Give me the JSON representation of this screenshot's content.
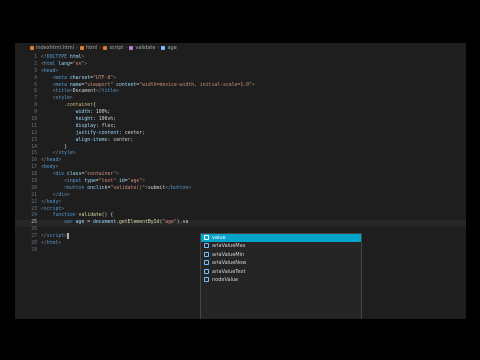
{
  "breadcrumb": [
    "indexhtml.html",
    "html",
    "script",
    "validate",
    "age"
  ],
  "code_lines": [
    {
      "n": "1",
      "segs": [
        [
          "punct",
          "<!"
        ],
        [
          "tag",
          "DOCTYPE"
        ],
        [
          "attr",
          " html"
        ],
        [
          "punct",
          ">"
        ]
      ]
    },
    {
      "n": "2",
      "segs": [
        [
          "punct",
          "<"
        ],
        [
          "tag",
          "html"
        ],
        [
          "attr",
          " lang"
        ],
        [
          "txt",
          "="
        ],
        [
          "str",
          "\"en\""
        ],
        [
          "punct",
          ">"
        ]
      ]
    },
    {
      "n": "3",
      "segs": [
        [
          "punct",
          "<"
        ],
        [
          "tag",
          "head"
        ],
        [
          "punct",
          ">"
        ]
      ]
    },
    {
      "n": "4",
      "segs": [
        [
          "txt",
          "    "
        ],
        [
          "punct",
          "<"
        ],
        [
          "tag",
          "meta"
        ],
        [
          "attr",
          " charset"
        ],
        [
          "txt",
          "="
        ],
        [
          "str",
          "\"UTF-8\""
        ],
        [
          "punct",
          ">"
        ]
      ]
    },
    {
      "n": "5",
      "segs": [
        [
          "txt",
          "    "
        ],
        [
          "punct",
          "<"
        ],
        [
          "tag",
          "meta"
        ],
        [
          "attr",
          " name"
        ],
        [
          "txt",
          "="
        ],
        [
          "str",
          "\"viewport\""
        ],
        [
          "attr",
          " content"
        ],
        [
          "txt",
          "="
        ],
        [
          "str",
          "\"width=device-width, initial-scale=1.0\""
        ],
        [
          "punct",
          ">"
        ]
      ]
    },
    {
      "n": "6",
      "segs": [
        [
          "txt",
          "    "
        ],
        [
          "punct",
          "<"
        ],
        [
          "tag",
          "title"
        ],
        [
          "punct",
          ">"
        ],
        [
          "txt",
          "Document"
        ],
        [
          "punct",
          "</"
        ],
        [
          "tag",
          "title"
        ],
        [
          "punct",
          ">"
        ]
      ]
    },
    {
      "n": "7",
      "segs": [
        [
          "txt",
          "    "
        ],
        [
          "punct",
          "<"
        ],
        [
          "tag",
          "style"
        ],
        [
          "punct",
          ">"
        ]
      ]
    },
    {
      "n": "8",
      "segs": [
        [
          "txt",
          "        "
        ],
        [
          "sel",
          ".container"
        ],
        [
          "txt",
          "{"
        ]
      ]
    },
    {
      "n": "9",
      "segs": [
        [
          "txt",
          "            "
        ],
        [
          "var",
          "width"
        ],
        [
          "txt",
          ": 100%;"
        ]
      ]
    },
    {
      "n": "10",
      "segs": [
        [
          "txt",
          "            "
        ],
        [
          "var",
          "height"
        ],
        [
          "txt",
          ": 100vh;"
        ]
      ]
    },
    {
      "n": "11",
      "segs": [
        [
          "txt",
          "            "
        ],
        [
          "var",
          "display"
        ],
        [
          "txt",
          ": flex;"
        ]
      ]
    },
    {
      "n": "12",
      "segs": [
        [
          "txt",
          "            "
        ],
        [
          "var",
          "justify-content"
        ],
        [
          "txt",
          ": center;"
        ]
      ]
    },
    {
      "n": "13",
      "segs": [
        [
          "txt",
          "            "
        ],
        [
          "var",
          "align-items"
        ],
        [
          "txt",
          ": center;"
        ]
      ]
    },
    {
      "n": "14",
      "segs": [
        [
          "txt",
          "        }"
        ]
      ]
    },
    {
      "n": "15",
      "segs": [
        [
          "txt",
          "    "
        ],
        [
          "punct",
          "</"
        ],
        [
          "tag",
          "style"
        ],
        [
          "punct",
          ">"
        ]
      ]
    },
    {
      "n": "16",
      "segs": [
        [
          "punct",
          "</"
        ],
        [
          "tag",
          "head"
        ],
        [
          "punct",
          ">"
        ]
      ]
    },
    {
      "n": "17",
      "segs": [
        [
          "punct",
          "<"
        ],
        [
          "tag",
          "body"
        ],
        [
          "punct",
          ">"
        ]
      ]
    },
    {
      "n": "18",
      "segs": [
        [
          "txt",
          "    "
        ],
        [
          "punct",
          "<"
        ],
        [
          "tag",
          "div"
        ],
        [
          "attr",
          " class"
        ],
        [
          "txt",
          "="
        ],
        [
          "str",
          "\"container\""
        ],
        [
          "punct",
          ">"
        ]
      ]
    },
    {
      "n": "19",
      "segs": [
        [
          "txt",
          "        "
        ],
        [
          "punct",
          "<"
        ],
        [
          "tag",
          "input"
        ],
        [
          "attr",
          " type"
        ],
        [
          "txt",
          "="
        ],
        [
          "str",
          "\"text\""
        ],
        [
          "attr",
          " id"
        ],
        [
          "txt",
          "="
        ],
        [
          "str",
          "\"age\""
        ],
        [
          "punct",
          ">"
        ]
      ]
    },
    {
      "n": "20",
      "segs": [
        [
          "txt",
          "        "
        ],
        [
          "punct",
          "<"
        ],
        [
          "tag",
          "button"
        ],
        [
          "attr",
          " onclick"
        ],
        [
          "txt",
          "="
        ],
        [
          "str",
          "\"validate()\""
        ],
        [
          "punct",
          ">"
        ],
        [
          "txt",
          "submit"
        ],
        [
          "punct",
          "</"
        ],
        [
          "tag",
          "button"
        ],
        [
          "punct",
          ">"
        ]
      ]
    },
    {
      "n": "21",
      "segs": [
        [
          "txt",
          "    "
        ],
        [
          "punct",
          "</"
        ],
        [
          "tag",
          "div"
        ],
        [
          "punct",
          ">"
        ]
      ]
    },
    {
      "n": "22",
      "segs": [
        [
          "punct",
          "</"
        ],
        [
          "tag",
          "body"
        ],
        [
          "punct",
          ">"
        ]
      ]
    },
    {
      "n": "23",
      "segs": [
        [
          "punct",
          "<"
        ],
        [
          "tag",
          "script"
        ],
        [
          "punct",
          ">"
        ]
      ]
    },
    {
      "n": "24",
      "segs": [
        [
          "txt",
          "    "
        ],
        [
          "kw",
          "function"
        ],
        [
          "fn",
          " validate"
        ],
        [
          "txt",
          "() {"
        ]
      ]
    },
    {
      "n": "25",
      "segs": [
        [
          "txt",
          "        "
        ],
        [
          "kw",
          "var"
        ],
        [
          "var",
          " age"
        ],
        [
          "txt",
          " = "
        ],
        [
          "var",
          "document"
        ],
        [
          "txt",
          "."
        ],
        [
          "fn",
          "getElementById"
        ],
        [
          "txt",
          "("
        ],
        [
          "str",
          "\"age\""
        ],
        [
          "txt",
          ").va"
        ]
      ]
    },
    {
      "n": "26",
      "segs": [
        [
          "txt",
          "    "
        ]
      ]
    },
    {
      "n": "27",
      "segs": [
        [
          "punct",
          "</"
        ],
        [
          "tag",
          "script"
        ],
        [
          "punct",
          ">"
        ]
      ]
    },
    {
      "n": "28",
      "segs": [
        [
          "punct",
          "</"
        ],
        [
          "tag",
          "html"
        ],
        [
          "punct",
          ">"
        ]
      ]
    },
    {
      "n": "29",
      "segs": []
    }
  ],
  "current_line": "25",
  "suggestions": [
    "value",
    "ariaValueMax",
    "ariaValueMin",
    "ariaValueNow",
    "ariaValueText",
    "nodeValue"
  ],
  "active_suggestion": 0
}
